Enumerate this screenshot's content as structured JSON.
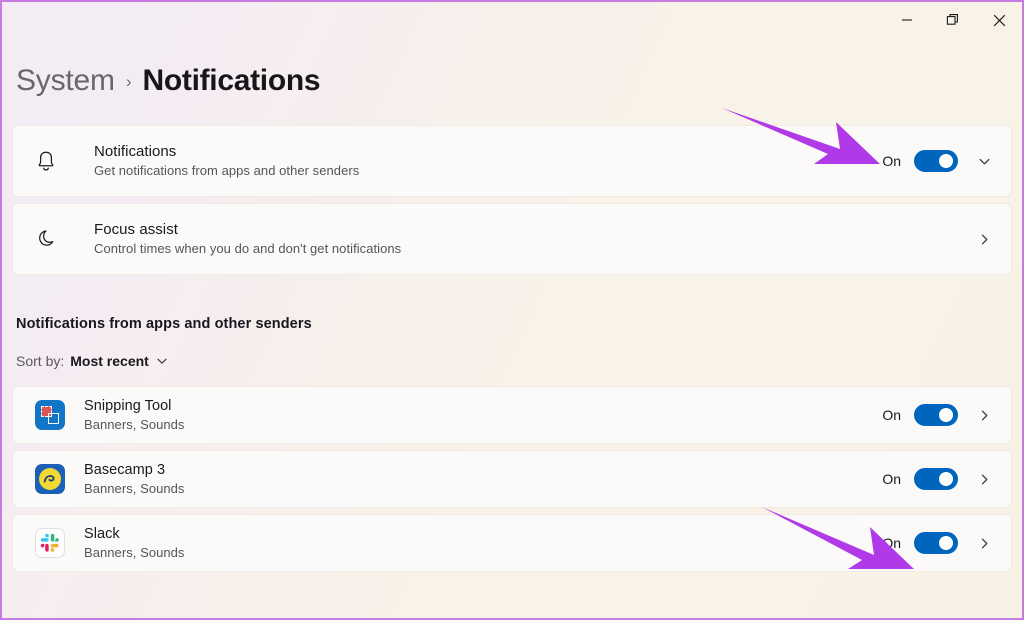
{
  "window": {
    "controls": [
      {
        "name": "minimize",
        "glyph": "minimize-icon",
        "label": "Minimize"
      },
      {
        "name": "restore",
        "glyph": "restore-icon",
        "label": "Restore"
      },
      {
        "name": "close",
        "glyph": "close-icon",
        "label": "Close"
      }
    ]
  },
  "breadcrumb": {
    "root": "System",
    "separator": "›",
    "current": "Notifications"
  },
  "settings_cards": [
    {
      "icon": "bell-icon",
      "title": "Notifications",
      "subtitle": "Get notifications from apps and other senders",
      "state": "On",
      "toggle_on": true,
      "expander": "chevron-down-icon"
    },
    {
      "icon": "moon-icon",
      "title": "Focus assist",
      "subtitle": "Control times when you do and don't get notifications",
      "state": "",
      "toggle_on": false,
      "expander": "chevron-right-icon"
    }
  ],
  "section": {
    "heading": "Notifications from apps and other senders",
    "sort_label": "Sort by:",
    "sort_value": "Most recent",
    "sort_chevron": "chevron-down-icon"
  },
  "apps": [
    {
      "icon": "snipping-tool-icon",
      "name": "Snipping Tool",
      "subtitle": "Banners, Sounds",
      "state": "On",
      "toggle_on": true,
      "expander": "chevron-right-icon"
    },
    {
      "icon": "basecamp-icon",
      "name": "Basecamp 3",
      "subtitle": "Banners, Sounds",
      "state": "On",
      "toggle_on": true,
      "expander": "chevron-right-icon"
    },
    {
      "icon": "slack-icon",
      "name": "Slack",
      "subtitle": "Banners, Sounds",
      "state": "On",
      "toggle_on": true,
      "expander": "chevron-right-icon"
    }
  ],
  "annotations": {
    "color": "#b03ae8",
    "arrows": [
      {
        "name": "arrow-pointing-notifications-toggle",
        "target": "Notifications toggle"
      },
      {
        "name": "arrow-pointing-slack-toggle",
        "target": "Slack toggle"
      }
    ]
  },
  "colors": {
    "accent_toggle": "#0066bd",
    "annotation_purple": "#b03ae8",
    "window_border": "#c77ae0",
    "card_background": "#fbfaf8"
  }
}
